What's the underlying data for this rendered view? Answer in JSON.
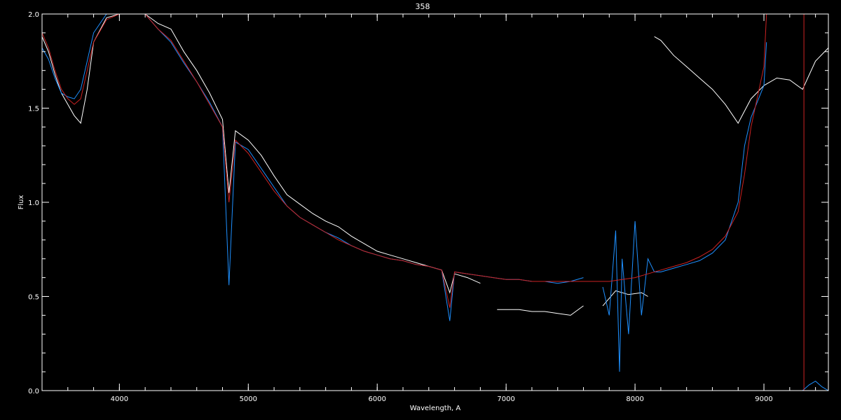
{
  "chart_data": {
    "type": "line",
    "title": "358",
    "xlabel": "Wavelength, A",
    "ylabel": "Flux",
    "xlim": [
      3400,
      9500
    ],
    "ylim": [
      0,
      2.0
    ],
    "xticks": [
      4000,
      5000,
      6000,
      7000,
      8000,
      9000
    ],
    "xtick_labels": [
      "4000",
      "5000",
      "6000",
      "7000",
      "8000",
      "9000"
    ],
    "yticks": [
      0,
      0.5,
      1.0,
      1.5,
      2.0
    ],
    "ytick_labels": [
      "0.0",
      "0.5",
      "1.0",
      "1.5",
      "2.0"
    ],
    "grid": false,
    "background": "#000000",
    "series": [
      {
        "color": "#ffffff",
        "segments": [
          [
            [
              3400,
              1.88
            ],
            [
              3450,
              1.8
            ],
            [
              3500,
              1.68
            ],
            [
              3550,
              1.58
            ],
            [
              3600,
              1.52
            ],
            [
              3650,
              1.46
            ],
            [
              3700,
              1.42
            ],
            [
              3750,
              1.6
            ],
            [
              3800,
              1.85
            ],
            [
              3900,
              1.98
            ],
            [
              4000,
              2.0
            ],
            [
              4100,
              2.0
            ],
            [
              4200,
              2.0
            ],
            [
              4300,
              1.95
            ],
            [
              4400,
              1.92
            ],
            [
              4500,
              1.8
            ],
            [
              4600,
              1.7
            ],
            [
              4700,
              1.58
            ],
            [
              4800,
              1.44
            ],
            [
              4850,
              1.05
            ],
            [
              4900,
              1.38
            ],
            [
              5000,
              1.33
            ],
            [
              5100,
              1.25
            ],
            [
              5200,
              1.14
            ],
            [
              5300,
              1.04
            ],
            [
              5400,
              0.99
            ],
            [
              5500,
              0.94
            ],
            [
              5600,
              0.9
            ],
            [
              5700,
              0.87
            ],
            [
              5800,
              0.82
            ],
            [
              5900,
              0.78
            ],
            [
              6000,
              0.74
            ],
            [
              6100,
              0.72
            ],
            [
              6200,
              0.7
            ],
            [
              6300,
              0.68
            ],
            [
              6400,
              0.66
            ],
            [
              6500,
              0.64
            ],
            [
              6563,
              0.52
            ],
            [
              6600,
              0.62
            ],
            [
              6700,
              0.6
            ],
            [
              6800,
              0.57
            ]
          ],
          [
            [
              6930,
              0.43
            ],
            [
              7000,
              0.43
            ],
            [
              7100,
              0.43
            ],
            [
              7200,
              0.42
            ],
            [
              7300,
              0.42
            ],
            [
              7400,
              0.41
            ],
            [
              7500,
              0.4
            ],
            [
              7600,
              0.45
            ]
          ],
          [
            [
              7750,
              0.45
            ],
            [
              7850,
              0.53
            ],
            [
              7950,
              0.51
            ],
            [
              8050,
              0.52
            ],
            [
              8100,
              0.5
            ]
          ],
          [
            [
              8150,
              1.88
            ],
            [
              8200,
              1.86
            ],
            [
              8300,
              1.78
            ],
            [
              8400,
              1.72
            ],
            [
              8500,
              1.66
            ],
            [
              8600,
              1.6
            ],
            [
              8700,
              1.52
            ],
            [
              8800,
              1.42
            ],
            [
              8900,
              1.55
            ],
            [
              9000,
              1.62
            ],
            [
              9100,
              1.66
            ],
            [
              9200,
              1.65
            ],
            [
              9300,
              1.6
            ],
            [
              9400,
              1.75
            ],
            [
              9500,
              1.82
            ]
          ]
        ]
      },
      {
        "color": "#1e90ff",
        "segments": [
          [
            [
              3400,
              1.82
            ],
            [
              3450,
              1.76
            ],
            [
              3500,
              1.66
            ],
            [
              3550,
              1.58
            ],
            [
              3600,
              1.56
            ],
            [
              3650,
              1.55
            ],
            [
              3700,
              1.6
            ],
            [
              3750,
              1.75
            ],
            [
              3800,
              1.9
            ],
            [
              3900,
              2.0
            ],
            [
              4000,
              2.0
            ],
            [
              4100,
              2.0
            ],
            [
              4200,
              2.0
            ],
            [
              4300,
              1.92
            ],
            [
              4400,
              1.85
            ],
            [
              4500,
              1.74
            ],
            [
              4600,
              1.64
            ],
            [
              4700,
              1.53
            ],
            [
              4800,
              1.4
            ],
            [
              4850,
              0.56
            ],
            [
              4900,
              1.32
            ],
            [
              5000,
              1.28
            ],
            [
              5100,
              1.18
            ],
            [
              5200,
              1.08
            ],
            [
              5300,
              0.98
            ],
            [
              5400,
              0.92
            ],
            [
              5500,
              0.88
            ],
            [
              5600,
              0.84
            ],
            [
              5700,
              0.81
            ],
            [
              5800,
              0.77
            ],
            [
              5900,
              0.74
            ],
            [
              6000,
              0.72
            ],
            [
              6100,
              0.7
            ],
            [
              6200,
              0.69
            ],
            [
              6300,
              0.67
            ],
            [
              6400,
              0.66
            ],
            [
              6500,
              0.64
            ],
            [
              6563,
              0.37
            ],
            [
              6600,
              0.63
            ],
            [
              6700,
              0.62
            ],
            [
              6800,
              0.61
            ],
            [
              6900,
              0.6
            ],
            [
              7000,
              0.59
            ],
            [
              7100,
              0.59
            ],
            [
              7200,
              0.58
            ],
            [
              7300,
              0.58
            ],
            [
              7400,
              0.57
            ],
            [
              7500,
              0.58
            ],
            [
              7600,
              0.6
            ]
          ],
          [
            [
              7750,
              0.55
            ],
            [
              7800,
              0.4
            ],
            [
              7850,
              0.85
            ],
            [
              7880,
              0.1
            ],
            [
              7900,
              0.7
            ],
            [
              7950,
              0.3
            ],
            [
              8000,
              0.9
            ],
            [
              8050,
              0.4
            ],
            [
              8100,
              0.7
            ],
            [
              8150,
              0.63
            ],
            [
              8200,
              0.63
            ],
            [
              8300,
              0.65
            ],
            [
              8400,
              0.67
            ],
            [
              8500,
              0.69
            ],
            [
              8600,
              0.73
            ],
            [
              8700,
              0.8
            ],
            [
              8800,
              1.0
            ],
            [
              8850,
              1.3
            ],
            [
              8900,
              1.45
            ],
            [
              9000,
              1.62
            ],
            [
              9020,
              1.85
            ]
          ],
          [
            [
              9300,
              0.0
            ],
            [
              9350,
              0.03
            ],
            [
              9400,
              0.05
            ],
            [
              9450,
              0.02
            ],
            [
              9500,
              0.0
            ]
          ]
        ]
      },
      {
        "color": "#cc2222",
        "segments": [
          [
            [
              3400,
              1.9
            ],
            [
              3450,
              1.82
            ],
            [
              3500,
              1.7
            ],
            [
              3550,
              1.6
            ],
            [
              3600,
              1.55
            ],
            [
              3650,
              1.52
            ],
            [
              3700,
              1.55
            ],
            [
              3750,
              1.7
            ],
            [
              3800,
              1.85
            ],
            [
              3900,
              1.97
            ],
            [
              4000,
              2.0
            ],
            [
              4100,
              2.0
            ],
            [
              4200,
              2.0
            ],
            [
              4300,
              1.92
            ],
            [
              4400,
              1.86
            ],
            [
              4500,
              1.75
            ],
            [
              4600,
              1.64
            ],
            [
              4700,
              1.52
            ],
            [
              4800,
              1.4
            ],
            [
              4850,
              1.0
            ],
            [
              4900,
              1.33
            ],
            [
              5000,
              1.26
            ],
            [
              5100,
              1.16
            ],
            [
              5200,
              1.06
            ],
            [
              5300,
              0.98
            ],
            [
              5400,
              0.92
            ],
            [
              5500,
              0.88
            ],
            [
              5600,
              0.84
            ],
            [
              5700,
              0.8
            ],
            [
              5800,
              0.77
            ],
            [
              5900,
              0.74
            ],
            [
              6000,
              0.72
            ],
            [
              6100,
              0.7
            ],
            [
              6200,
              0.69
            ],
            [
              6300,
              0.67
            ],
            [
              6400,
              0.66
            ],
            [
              6500,
              0.64
            ],
            [
              6563,
              0.44
            ],
            [
              6600,
              0.63
            ],
            [
              6700,
              0.62
            ],
            [
              6800,
              0.61
            ],
            [
              6900,
              0.6
            ],
            [
              7000,
              0.59
            ],
            [
              7100,
              0.59
            ],
            [
              7200,
              0.58
            ],
            [
              7300,
              0.58
            ],
            [
              7400,
              0.58
            ],
            [
              7500,
              0.58
            ],
            [
              7600,
              0.58
            ],
            [
              7700,
              0.58
            ],
            [
              7800,
              0.58
            ],
            [
              7900,
              0.59
            ],
            [
              8000,
              0.6
            ],
            [
              8100,
              0.62
            ],
            [
              8200,
              0.64
            ],
            [
              8300,
              0.66
            ],
            [
              8400,
              0.68
            ],
            [
              8500,
              0.71
            ],
            [
              8600,
              0.75
            ],
            [
              8700,
              0.82
            ],
            [
              8800,
              0.95
            ],
            [
              8850,
              1.15
            ],
            [
              8900,
              1.4
            ],
            [
              9000,
              1.72
            ],
            [
              9020,
              2.0
            ]
          ],
          [
            [
              9310,
              2.0
            ],
            [
              9310,
              0.0
            ],
            [
              9500,
              0.0
            ]
          ]
        ]
      }
    ]
  }
}
